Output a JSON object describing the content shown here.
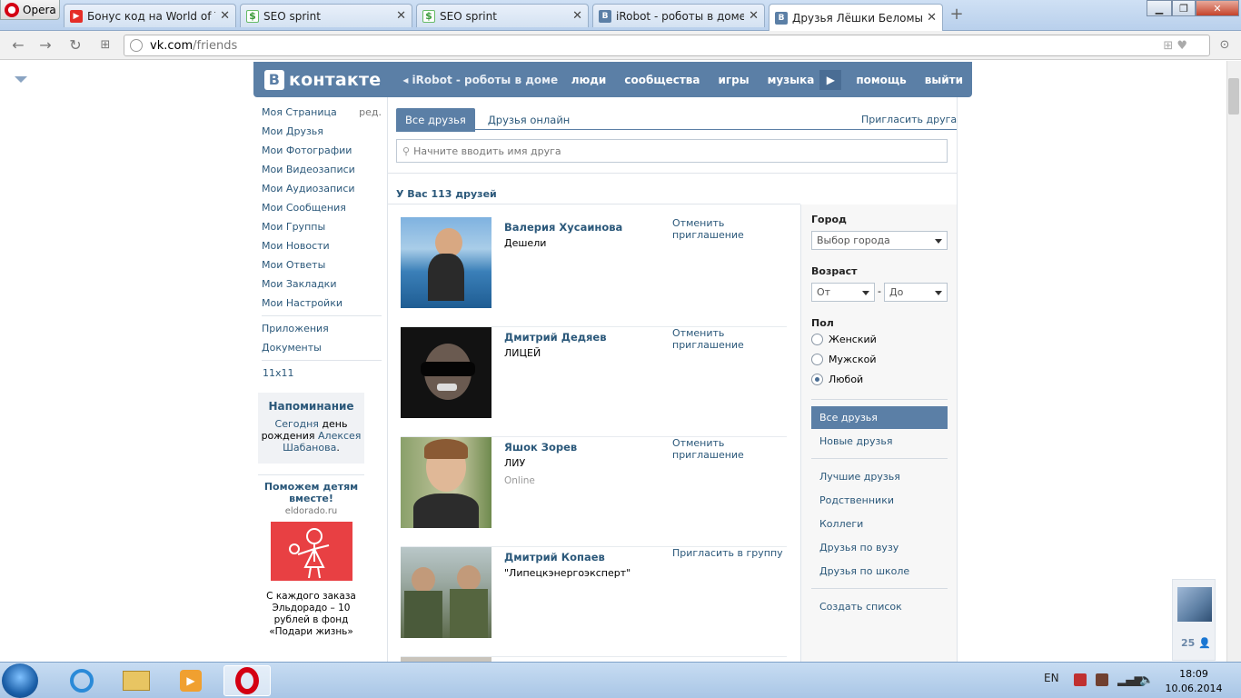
{
  "browser": {
    "menu_label": "Opera",
    "tabs": [
      {
        "title": "Бонус код на World of Tanks",
        "icon": "youtube-icon"
      },
      {
        "title": "SEO sprint",
        "icon": "seosprint-icon"
      },
      {
        "title": "SEO sprint",
        "icon": "seosprint-icon"
      },
      {
        "title": "iRobot - роботы в доме",
        "icon": "vk-icon"
      },
      {
        "title": "Друзья Лёшки Беломытцева",
        "icon": "vk-icon"
      }
    ],
    "url_host": "vk.com",
    "url_path": "/friends"
  },
  "vk": {
    "logo_letter": "В",
    "logo_text": "контакте",
    "back_link": "iRobot - роботы в доме",
    "nav": [
      "люди",
      "сообщества",
      "игры",
      "музыка",
      "помощь",
      "выйти"
    ]
  },
  "leftmenu": {
    "edit": "ред.",
    "items": [
      "Моя Страница",
      "Мои Друзья",
      "Мои Фотографии",
      "Мои Видеозаписи",
      "Мои Аудиозаписи",
      "Мои Сообщения",
      "Мои Группы",
      "Мои Новости",
      "Мои Ответы",
      "Мои Закладки",
      "Мои Настройки"
    ],
    "apps": [
      "Приложения",
      "Документы"
    ],
    "games": [
      "11x11"
    ]
  },
  "reminder": {
    "title": "Напоминание",
    "today": "Сегодня",
    "text1": " день рождения ",
    "person": "Алексея Шабанова",
    "dot": "."
  },
  "ad": {
    "title": "Поможем детям вместе!",
    "domain": "eldorado.ru",
    "text": "С каждого заказа Эльдорадо – 10 рублей в фонд «Подари жизнь»"
  },
  "friends_page": {
    "tab_all": "Все друзья",
    "tab_online": "Друзья онлайн",
    "invite": "Пригласить друга",
    "search_placeholder": "Начните вводить имя друга",
    "count": "У Вас 113 друзей",
    "friends": [
      {
        "name": "Валерия Хусаинова",
        "sub": "Дешели",
        "status": "",
        "action": "Отменить приглашение"
      },
      {
        "name": "Дмитрий Дедяев",
        "sub": "ЛИЦЕЙ",
        "status": "",
        "action": "Отменить приглашение"
      },
      {
        "name": "Яшок Зорев",
        "sub": "ЛИУ",
        "status": "Online",
        "action": "Отменить приглашение"
      },
      {
        "name": "Дмитрий Копаев",
        "sub": "\"Липецкэнергоэксперт\"",
        "status": "",
        "action": "Пригласить в группу"
      }
    ]
  },
  "filters": {
    "city_label": "Город",
    "city_value": "Выбор города",
    "age_label": "Возраст",
    "age_from": "От",
    "age_dash": "-",
    "age_to": "До",
    "sex_label": "Пол",
    "sex_options": [
      "Женский",
      "Мужской",
      "Любой"
    ],
    "sex_selected": "Любой",
    "menu": [
      "Все друзья",
      "Новые друзья"
    ],
    "lists": [
      "Лучшие друзья",
      "Родственники",
      "Коллеги",
      "Друзья по вузу",
      "Друзья по школе"
    ],
    "create": "Создать список"
  },
  "chat": {
    "count": "25"
  },
  "taskbar": {
    "lang": "EN",
    "time": "18:09",
    "date": "10.06.2014"
  },
  "colors": {
    "vk_blue": "#5b7fa6",
    "link": "#2b587a"
  }
}
